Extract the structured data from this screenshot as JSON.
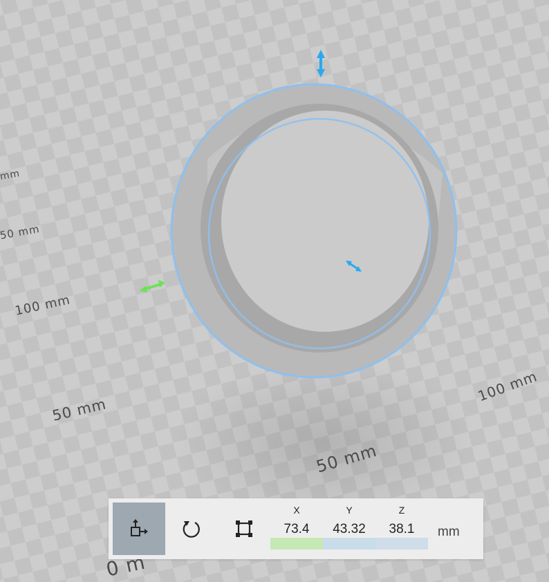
{
  "viewport": {
    "grid_labels": [
      {
        "id": "mm-a",
        "text": "mm"
      },
      {
        "id": "mm-b",
        "text": "50 mm"
      },
      {
        "id": "mm-c",
        "text": "100 mm"
      },
      {
        "id": "mm-d",
        "text": "50 mm"
      },
      {
        "id": "mm-e",
        "text": "100 mm"
      },
      {
        "id": "mm-f",
        "text": "50 mm"
      },
      {
        "id": "mm-g",
        "text": "0 m"
      }
    ],
    "selection_color": "#8ec0ee",
    "x_axis_color": "#6fe05a",
    "z_axis_color": "#2aa9f0"
  },
  "toolbar": {
    "tools": [
      {
        "name": "move-tool",
        "icon": "move-icon",
        "active": true
      },
      {
        "name": "rotate-tool",
        "icon": "rotate-icon",
        "active": false
      },
      {
        "name": "scale-tool",
        "icon": "scale-icon",
        "active": false
      }
    ],
    "coords": {
      "x": {
        "label": "X",
        "value": "73.4",
        "bar_color": "#c6e8b4"
      },
      "y": {
        "label": "Y",
        "value": "43.32",
        "bar_color": "#c9dcea"
      },
      "z": {
        "label": "Z",
        "value": "38.1",
        "bar_color": "#cfdde8"
      }
    },
    "unit": "mm"
  }
}
